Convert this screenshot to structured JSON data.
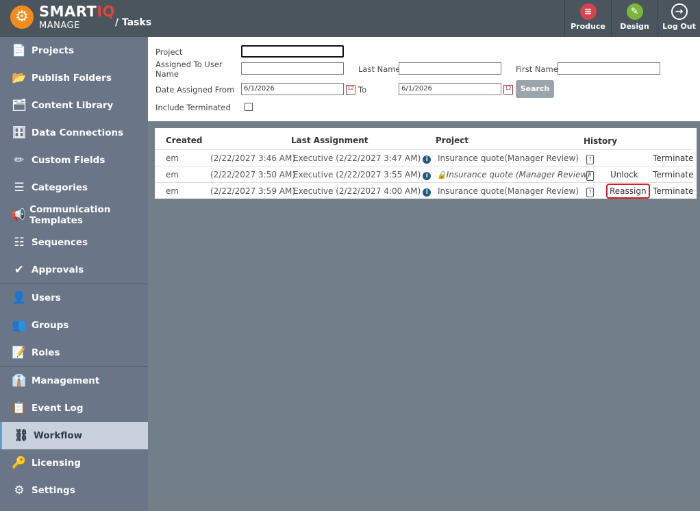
{
  "header": {
    "brand": "SMART",
    "brand_accent": "IQ",
    "sub": "MANAGE",
    "breadcrumb": "/ Tasks",
    "buttons": [
      {
        "label": "Produce",
        "color": "#d5434f"
      },
      {
        "label": "Design",
        "color": "#7cb53a"
      },
      {
        "label": "Log Out"
      }
    ]
  },
  "sidebar": {
    "items": [
      "Projects",
      "Publish Folders",
      "Content Library",
      "Data Connections",
      "Custom Fields",
      "Categories",
      "Communication Templates",
      "Sequences",
      "Approvals",
      "Users",
      "Groups",
      "Roles",
      "Management",
      "Event Log",
      "Workflow",
      "Licensing",
      "Settings"
    ],
    "active": "Workflow"
  },
  "filters": {
    "project_label": "Project",
    "project_value": "",
    "assigned_label": "Assigned To User Name",
    "assigned_value": "",
    "last_name_label": "Last Name",
    "last_name_value": "",
    "first_name_label": "First Name",
    "first_name_value": "",
    "date_from_label": "Date Assigned From",
    "date_from": "6/1/2026",
    "to_label": "To",
    "date_to": "6/1/2026",
    "search_label": "Search",
    "include_terminated_label": "Include Terminated",
    "include_terminated": false
  },
  "table": {
    "headers": [
      "Created",
      "Last Assignment",
      "Project",
      "History"
    ],
    "rows": [
      {
        "user": "em",
        "created": "(2/22/2027 3:46 AM)",
        "last": "Executive (2/22/2027 3:47 AM)",
        "project": "Insurance quote(Manager Review)",
        "locked": false,
        "action": "",
        "terminate": "Terminate"
      },
      {
        "user": "em",
        "created": "(2/22/2027 3:50 AM)",
        "last": "Executive (2/22/2027 3:55 AM)",
        "project": "Insurance quote (Manager Review)",
        "locked": true,
        "action": "Unlock",
        "terminate": "Terminate"
      },
      {
        "user": "em",
        "created": "(2/22/2027 3:59 AM)",
        "last": "Executive (2/22/2027 4:00 AM)",
        "project": "Insurance quote(Manager Review)",
        "locked": false,
        "action": "Reassign",
        "terminate": "Terminate"
      }
    ]
  }
}
